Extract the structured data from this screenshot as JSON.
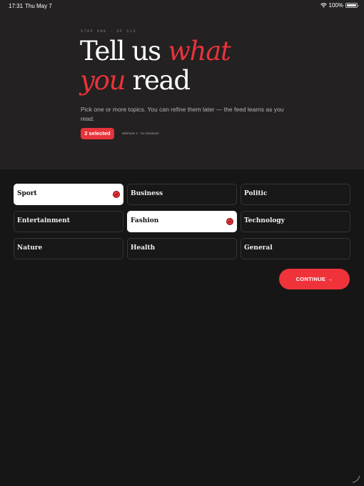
{
  "status_bar": {
    "time": "17:31",
    "date": "Thu May 7",
    "battery": "100%",
    "wifi_icon": "wifi-icon",
    "battery_icon": "battery-icon"
  },
  "header": {
    "step_label": "STEP ONE · OF SIX",
    "headline_part1": "Tell us ",
    "headline_accent1": "what",
    "headline_accent2": "you",
    "headline_part2": " read",
    "subtitle": "Pick one or more topics. You can refine them later — the feed learns as you read.",
    "selected_badge": "2 selected",
    "constraint_note": "Minimum 1 · no maximum"
  },
  "topics": [
    {
      "label": "Sport",
      "selected": true
    },
    {
      "label": "Business",
      "selected": false
    },
    {
      "label": "Politic",
      "selected": false
    },
    {
      "label": "Entertainment",
      "selected": false
    },
    {
      "label": "Fashion",
      "selected": true
    },
    {
      "label": "Technology",
      "selected": false
    },
    {
      "label": "Nature",
      "selected": false
    },
    {
      "label": "Health",
      "selected": false
    },
    {
      "label": "General",
      "selected": false
    }
  ],
  "continue_label": "CONTINUE →",
  "colors": {
    "accent": "#e8333a",
    "header_bg": "#232121",
    "page_bg": "#161616",
    "card_bg": "#191818",
    "selected_card_bg": "#ffffff"
  }
}
